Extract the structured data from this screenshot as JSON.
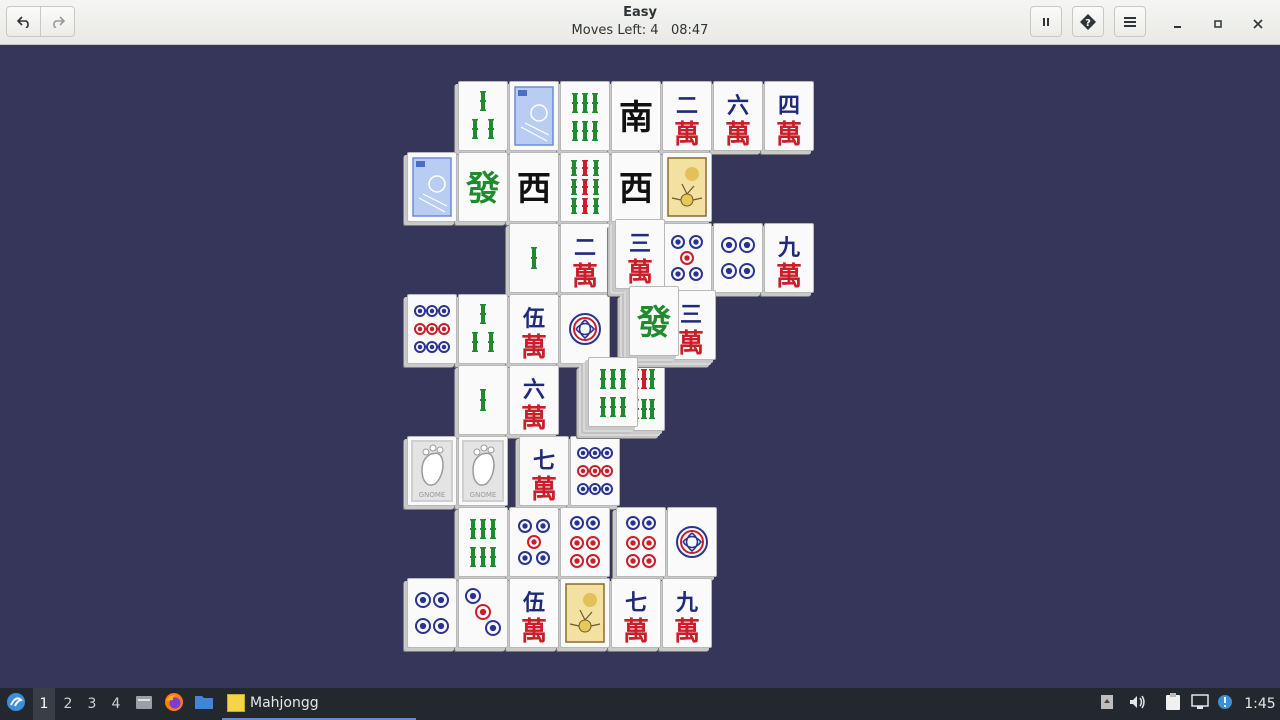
{
  "window": {
    "title": "Easy",
    "moves_left_label": "Moves Left:",
    "moves_left_value": "4",
    "timer": "08:47"
  },
  "header_buttons": {
    "undo": "undo-icon",
    "redo": "redo-icon",
    "pause": "pause-icon",
    "hint": "hint-icon",
    "menu": "hamburger-menu-icon",
    "minimize": "minimize-icon",
    "maximize": "maximize-icon",
    "close": "close-icon"
  },
  "colors": {
    "board_background": "#35365a",
    "tile_face": "#fafafa",
    "bamboo_green": "#1f8a2e",
    "character_blue": "#1f2a78",
    "character_red": "#c81f2a",
    "dot_blue": "#2a3490",
    "dot_red": "#c81f2a"
  },
  "tiles": [
    {
      "row": 0,
      "col": 1,
      "layer": 1,
      "suit": "bamboo",
      "value": 3
    },
    {
      "row": 0,
      "col": 2,
      "layer": 1,
      "suit": "season",
      "value": 1
    },
    {
      "row": 0,
      "col": 3,
      "layer": 1,
      "suit": "bamboo",
      "value": 6
    },
    {
      "row": 0,
      "col": 4,
      "layer": 1,
      "suit": "wind",
      "glyph": "南"
    },
    {
      "row": 0,
      "col": 5,
      "layer": 1,
      "suit": "character",
      "glyph": "二"
    },
    {
      "row": 0,
      "col": 6,
      "layer": 1,
      "suit": "character",
      "glyph": "六"
    },
    {
      "row": 0,
      "col": 7,
      "layer": 1,
      "suit": "character",
      "glyph": "四"
    },
    {
      "row": 1,
      "col": 0,
      "layer": 1,
      "suit": "season",
      "value": 3
    },
    {
      "row": 1,
      "col": 1,
      "layer": 1,
      "suit": "dragon",
      "glyph": "發"
    },
    {
      "row": 1,
      "col": 2,
      "layer": 1,
      "suit": "wind",
      "glyph": "西"
    },
    {
      "row": 1,
      "col": 3,
      "layer": 1,
      "suit": "bamboo",
      "value": 9
    },
    {
      "row": 1,
      "col": 4,
      "layer": 1,
      "suit": "wind",
      "glyph": "西"
    },
    {
      "row": 1,
      "col": 5,
      "layer": 1,
      "suit": "flower",
      "value": 1
    },
    {
      "row": 2,
      "col": 2,
      "layer": 1,
      "suit": "bamboo",
      "value": 1
    },
    {
      "row": 2,
      "col": 3,
      "layer": 1,
      "suit": "character",
      "glyph": "二"
    },
    {
      "row": 2,
      "col": 4,
      "layer": 2,
      "suit": "character",
      "glyph": "三"
    },
    {
      "row": 2,
      "col": 5,
      "layer": 1,
      "suit": "dots",
      "value": 5
    },
    {
      "row": 2,
      "col": 6,
      "layer": 1,
      "suit": "dots",
      "value": 4
    },
    {
      "row": 2,
      "col": 7,
      "layer": 1,
      "suit": "character",
      "glyph": "九"
    },
    {
      "row": 3,
      "col": 0,
      "layer": 1,
      "suit": "dots",
      "value": 9
    },
    {
      "row": 3,
      "col": 1,
      "layer": 1,
      "suit": "bamboo",
      "value": 3
    },
    {
      "row": 3,
      "col": 2,
      "layer": 1,
      "suit": "character",
      "glyph": "伍"
    },
    {
      "row": 3,
      "col": 3,
      "layer": 1,
      "suit": "dots",
      "value": 1
    },
    {
      "row": 3,
      "col": 5,
      "layer": 2,
      "suit": "character",
      "glyph": "三"
    },
    {
      "row": 3,
      "col": 4.2,
      "layer": 3,
      "suit": "dragon",
      "glyph": "發"
    },
    {
      "row": 4,
      "col": 1,
      "layer": 1,
      "suit": "bamboo",
      "value": 1
    },
    {
      "row": 4,
      "col": 2,
      "layer": 1,
      "suit": "character",
      "glyph": "六"
    },
    {
      "row": 4,
      "col": 4,
      "layer": 2,
      "suit": "bamboo",
      "value": 8
    },
    {
      "row": 4,
      "col": 3.4,
      "layer": 3,
      "suit": "bamboo",
      "value": 6
    },
    {
      "row": 5,
      "col": 0,
      "layer": 1,
      "suit": "gnome",
      "label": "GNOME"
    },
    {
      "row": 5,
      "col": 1,
      "layer": 1,
      "suit": "gnome",
      "label": "GNOME"
    },
    {
      "row": 5,
      "col": 2.2,
      "layer": 1,
      "suit": "character",
      "glyph": "七"
    },
    {
      "row": 5,
      "col": 3.2,
      "layer": 1,
      "suit": "dots",
      "value": 9
    },
    {
      "row": 6,
      "col": 1,
      "layer": 1,
      "suit": "bamboo",
      "value": 6
    },
    {
      "row": 6,
      "col": 2,
      "layer": 1,
      "suit": "dots",
      "value": 5
    },
    {
      "row": 6,
      "col": 3,
      "layer": 1,
      "suit": "dots",
      "value": 6
    },
    {
      "row": 6,
      "col": 4.1,
      "layer": 1,
      "suit": "dots",
      "value": 6
    },
    {
      "row": 6,
      "col": 5.1,
      "layer": 1,
      "suit": "dots",
      "value": 1
    },
    {
      "row": 7,
      "col": 0,
      "layer": 1,
      "suit": "dots",
      "value": 4
    },
    {
      "row": 7,
      "col": 1,
      "layer": 1,
      "suit": "dots",
      "value": 3
    },
    {
      "row": 7,
      "col": 2,
      "layer": 1,
      "suit": "character",
      "glyph": "伍"
    },
    {
      "row": 7,
      "col": 3,
      "layer": 1,
      "suit": "flower",
      "value": 2
    },
    {
      "row": 7,
      "col": 4,
      "layer": 1,
      "suit": "character",
      "glyph": "七"
    },
    {
      "row": 7,
      "col": 5,
      "layer": 1,
      "suit": "character",
      "glyph": "九"
    }
  ],
  "taskbar": {
    "start_icon": "distro-logo-icon",
    "workspaces": [
      "1",
      "2",
      "3",
      "4"
    ],
    "active_workspace": "1",
    "launchers": [
      "file-manager-icon",
      "firefox-icon",
      "folder-icon"
    ],
    "task_label": "Mahjongg",
    "tray_icons": [
      "tray-up-icon",
      "volume-icon",
      "clipboard-icon",
      "network-icon",
      "notification-icon"
    ],
    "clock": "1:45"
  }
}
